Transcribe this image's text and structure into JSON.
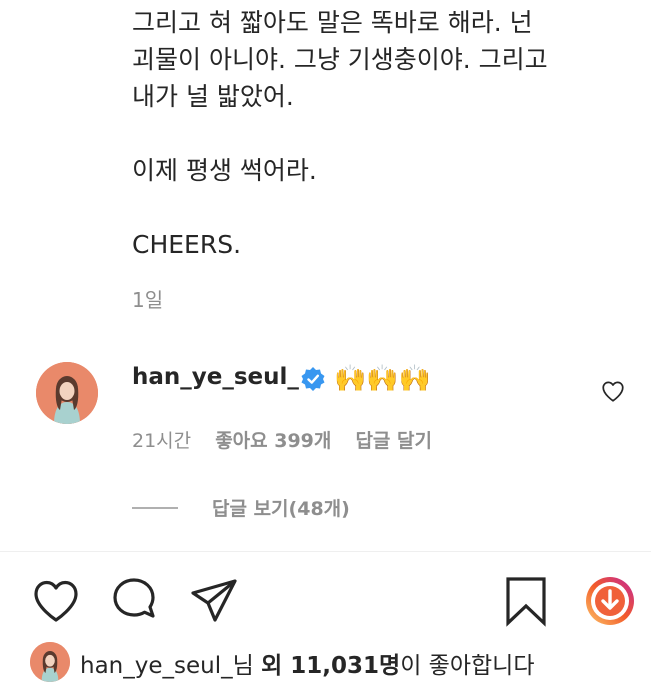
{
  "caption": {
    "lines_a": [
      "그리고 혀 짧아도 말은 똑바로 해라. 넌",
      "괴물이 아니야. 그냥 기생충이야. 그리고",
      "내가 널 밟았어."
    ],
    "line_b": "이제 평생 썩어라.",
    "line_c": "CHEERS.",
    "time": "1일"
  },
  "comment": {
    "username": "han_ye_seul_",
    "emojis": "🙌🙌🙌",
    "time": "21시간",
    "likes": "좋아요 399개",
    "reply_button": "답글 달기",
    "view_replies": "답글 보기(48개)"
  },
  "likes_bar": {
    "username": "han_ye_seul_",
    "suffix1": "님 ",
    "others": "외 11,031명",
    "suffix2": "이 좋아합니다"
  },
  "colors": {
    "verified": "#3897f0",
    "muted": "#8e8e8e",
    "avatar_bg": "#e9896a"
  },
  "icons": [
    "heart-icon",
    "comment-icon",
    "share-icon",
    "bookmark-icon",
    "download-icon",
    "verified-icon"
  ]
}
